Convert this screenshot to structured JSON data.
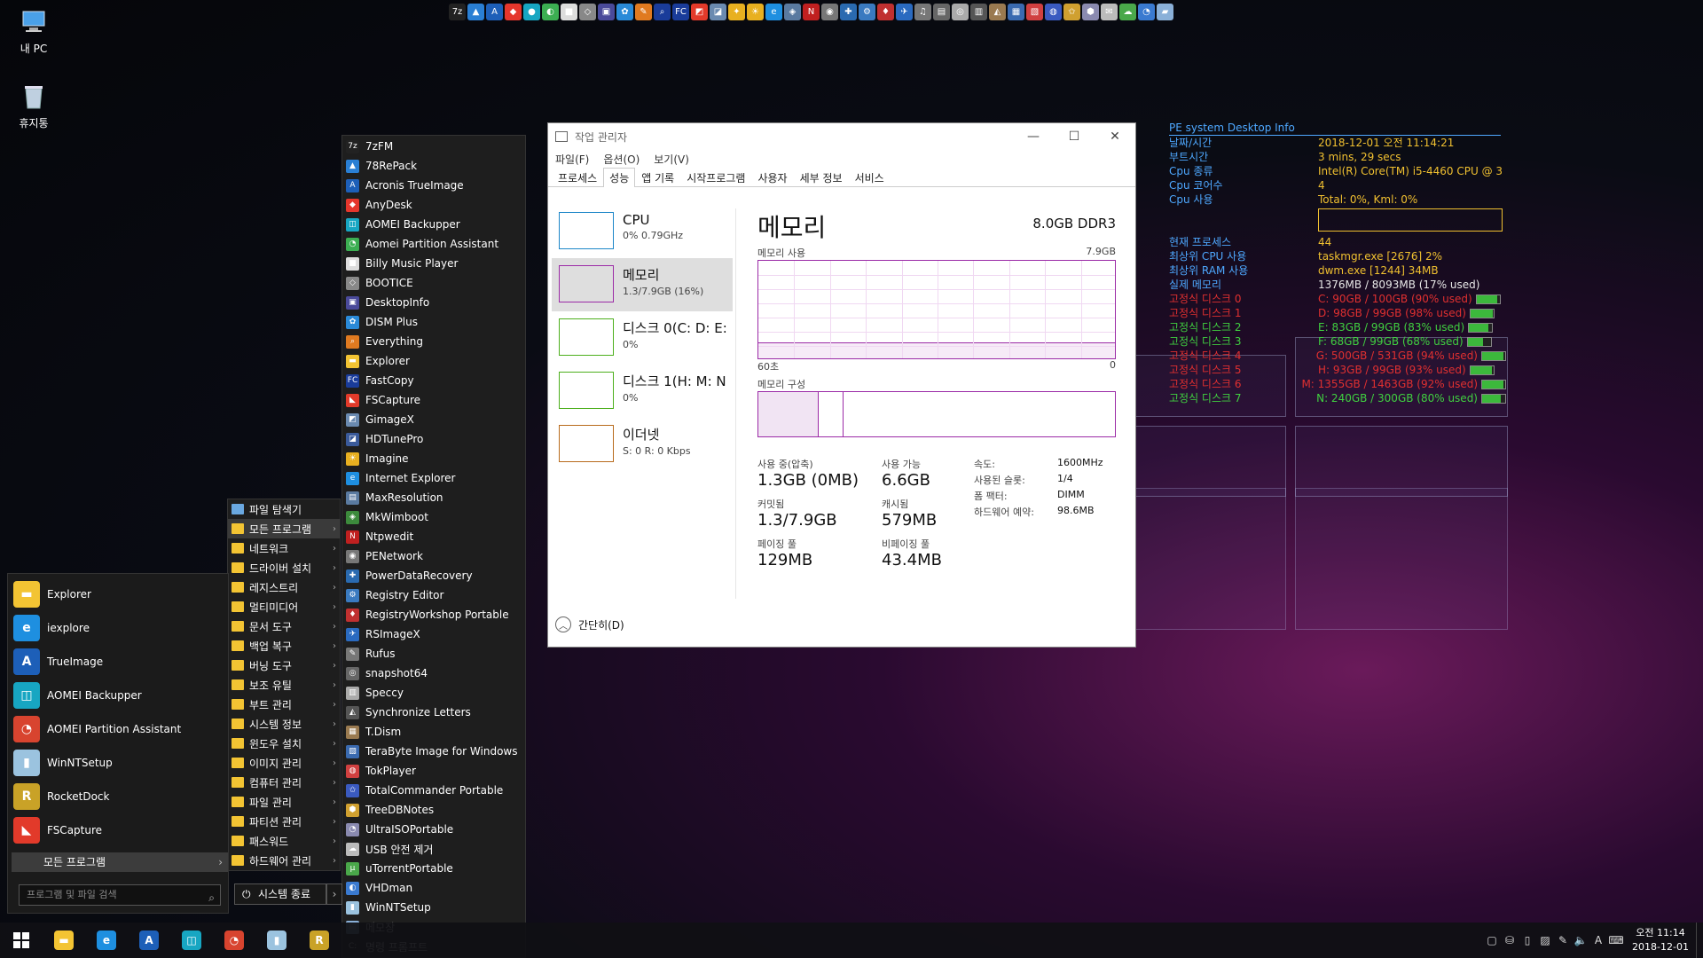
{
  "desktop": {
    "icons": [
      {
        "label": "내 PC",
        "icon": "computer-icon"
      },
      {
        "label": "휴지통",
        "icon": "recycle-bin-icon"
      }
    ]
  },
  "quickbar": {
    "icons": [
      "7z",
      "▲",
      "A",
      "◆",
      "●",
      "◐",
      "■",
      "◇",
      "▣",
      "✿",
      "✎",
      "⌕",
      "FC",
      "◩",
      "◪",
      "✦",
      "☀",
      "e",
      "◈",
      "N",
      "◉",
      "✚",
      "⚙",
      "♦",
      "✈",
      "♫",
      "▤",
      "◎",
      "▥",
      "◭",
      "▦",
      "▧",
      "◍",
      "✩",
      "⬢",
      "✉",
      "☁",
      "◔",
      "▰"
    ]
  },
  "desktop_info": {
    "title": "PE system  Desktop Info",
    "rows": [
      {
        "k": "날짜/시간",
        "v": "2018-12-01 오전 11:14:21",
        "style": "yellow"
      },
      {
        "k": "부트시간",
        "v": "3 mins, 29 secs",
        "style": "yellow"
      },
      {
        "k": "Cpu 종류",
        "v": "Intel(R) Core(TM) i5-4460  CPU @ 3",
        "style": "yellow"
      },
      {
        "k": "Cpu 코어수",
        "v": "4",
        "style": "yellow"
      },
      {
        "k": "Cpu 사용",
        "v": "Total: 0%, Kml: 0%",
        "style": "yellow"
      }
    ],
    "rows2": [
      {
        "k": "현재 프로세스",
        "v": "44",
        "style": "yellow"
      },
      {
        "k": "최상위 CPU 사용",
        "v": "taskmgr.exe [2676] 2%",
        "style": "yellow"
      },
      {
        "k": "최상위 RAM 사용",
        "v": "dwm.exe [1244] 34MB",
        "style": "yellow"
      },
      {
        "k": "실제 메모리",
        "v": "1376MB / 8093MB (17% used)",
        "style": "plain"
      }
    ],
    "disks": [
      {
        "k": "고정식 디스크 0",
        "v": "C: 90GB / 100GB (90% used)",
        "style": "red",
        "fill": 0.9
      },
      {
        "k": "고정식 디스크 1",
        "v": "D: 98GB / 99GB (98% used)",
        "style": "red",
        "fill": 0.98
      },
      {
        "k": "고정식 디스크 2",
        "v": "E: 83GB / 99GB (83% used)",
        "style": "green",
        "fill": 0.83
      },
      {
        "k": "고정식 디스크 3",
        "v": "F: 68GB / 99GB (68% used)",
        "style": "green",
        "fill": 0.68
      },
      {
        "k": "고정식 디스크 4",
        "v": "G: 500GB / 531GB (94% used)",
        "style": "red",
        "fill": 0.94
      },
      {
        "k": "고정식 디스크 5",
        "v": "H: 93GB / 99GB (93% used)",
        "style": "red",
        "fill": 0.93
      },
      {
        "k": "고정식 디스크 6",
        "v": "M: 1355GB / 1463GB (92% used)",
        "style": "red",
        "fill": 0.92
      },
      {
        "k": "고정식 디스크 7",
        "v": "N: 240GB / 300GB (80% used)",
        "style": "green",
        "fill": 0.8
      }
    ]
  },
  "start_menu": {
    "pinned": [
      {
        "label": "Explorer",
        "icon": "folder-icon",
        "color": "#f3c433",
        "glyph": "▬"
      },
      {
        "label": "iexplore",
        "icon": "ie-icon",
        "color": "#1e8fe0",
        "glyph": "e"
      },
      {
        "label": "TrueImage",
        "icon": "trueimage-icon",
        "color": "#1d5fb8",
        "glyph": "A"
      },
      {
        "label": "AOMEI Backupper",
        "icon": "backupper-icon",
        "color": "#17a6c2",
        "glyph": "◫"
      },
      {
        "label": "AOMEI Partition Assistant",
        "icon": "partition-icon",
        "color": "#d8442f",
        "glyph": "◔"
      },
      {
        "label": "WinNTSetup",
        "icon": "winntsetup-icon",
        "color": "#9bc3df",
        "glyph": "▮"
      },
      {
        "label": "RocketDock",
        "icon": "rocketdock-icon",
        "color": "#c9a227",
        "glyph": "R"
      },
      {
        "label": "FSCapture",
        "icon": "fscapture-icon",
        "color": "#e23a2a",
        "glyph": "◣"
      }
    ],
    "all_programs": "모든 프로그램",
    "search_placeholder": "프로그램 및 파일 검색",
    "shutdown": "시스템 종료"
  },
  "submenu": {
    "items": [
      {
        "label": "파일 탐색기",
        "arrow": false
      },
      {
        "label": "모든 프로그램",
        "arrow": true,
        "active": true
      },
      {
        "label": "네트워크",
        "arrow": true
      },
      {
        "label": "드라이버 설치",
        "arrow": true
      },
      {
        "label": "레지스트리",
        "arrow": true
      },
      {
        "label": "멀티미디어",
        "arrow": true
      },
      {
        "label": "문서 도구",
        "arrow": true
      },
      {
        "label": "백업 복구",
        "arrow": true
      },
      {
        "label": "버닝 도구",
        "arrow": true
      },
      {
        "label": "보조 유틸",
        "arrow": true
      },
      {
        "label": "부트 관리",
        "arrow": true
      },
      {
        "label": "시스템 정보",
        "arrow": true
      },
      {
        "label": "윈도우 설치",
        "arrow": true
      },
      {
        "label": "이미지 관리",
        "arrow": true
      },
      {
        "label": "컴퓨터 관리",
        "arrow": true
      },
      {
        "label": "파일 관리",
        "arrow": true
      },
      {
        "label": "파티션 관리",
        "arrow": true
      },
      {
        "label": "패스워드",
        "arrow": true
      },
      {
        "label": "하드웨어 관리",
        "arrow": true
      }
    ]
  },
  "programs": [
    {
      "label": "7zFM",
      "color": "#222",
      "glyph": "7z"
    },
    {
      "label": "78RePack",
      "color": "#2a7fd4",
      "glyph": "▲"
    },
    {
      "label": "Acronis TrueImage",
      "color": "#1d5fb8",
      "glyph": "A"
    },
    {
      "label": "AnyDesk",
      "color": "#e5362c",
      "glyph": "◆"
    },
    {
      "label": "AOMEI Backupper",
      "color": "#17a6c2",
      "glyph": "◫"
    },
    {
      "label": "Aomei Partition Assistant",
      "color": "#3cae52",
      "glyph": "◔"
    },
    {
      "label": "Billy Music Player",
      "color": "#ddd",
      "glyph": "■"
    },
    {
      "label": "BOOTICE",
      "color": "#888",
      "glyph": "◇"
    },
    {
      "label": "DesktopInfo",
      "color": "#4a4a9a",
      "glyph": "▣"
    },
    {
      "label": "DISM Plus",
      "color": "#2a8ad8",
      "glyph": "✿"
    },
    {
      "label": "Everything",
      "color": "#e07a20",
      "glyph": "⌕"
    },
    {
      "label": "Explorer",
      "color": "#f3c433",
      "glyph": "▬"
    },
    {
      "label": "FastCopy",
      "color": "#1a3c9a",
      "glyph": "FC"
    },
    {
      "label": "FSCapture",
      "color": "#e23a2a",
      "glyph": "◣"
    },
    {
      "label": "GimageX",
      "color": "#6a8ab0",
      "glyph": "◩"
    },
    {
      "label": "HDTunePro",
      "color": "#3a5a9a",
      "glyph": "◪"
    },
    {
      "label": "Imagine",
      "color": "#e8b020",
      "glyph": "☀"
    },
    {
      "label": "Internet Explorer",
      "color": "#1e8fe0",
      "glyph": "e"
    },
    {
      "label": "MaxResolution",
      "color": "#5a7aa0",
      "glyph": "▤"
    },
    {
      "label": "MkWimboot",
      "color": "#3c8a3c",
      "glyph": "◈"
    },
    {
      "label": "Ntpwedit",
      "color": "#c02020",
      "glyph": "N"
    },
    {
      "label": "PENetwork",
      "color": "#777",
      "glyph": "◉"
    },
    {
      "label": "PowerDataRecovery",
      "color": "#2a6ab0",
      "glyph": "✚"
    },
    {
      "label": "Registry Editor",
      "color": "#3a7ac0",
      "glyph": "⚙"
    },
    {
      "label": "RegistryWorkshop Portable",
      "color": "#c03030",
      "glyph": "♦"
    },
    {
      "label": "RSImageX",
      "color": "#2a6ac0",
      "glyph": "✈"
    },
    {
      "label": "Rufus",
      "color": "#777",
      "glyph": "✎"
    },
    {
      "label": "snapshot64",
      "color": "#666",
      "glyph": "◎"
    },
    {
      "label": "Speccy",
      "color": "#aaa",
      "glyph": "▥"
    },
    {
      "label": "Synchronize Letters",
      "color": "#555",
      "glyph": "◭"
    },
    {
      "label": "T.Dism",
      "color": "#9a7a50",
      "glyph": "▦"
    },
    {
      "label": "TeraByte Image for Windows",
      "color": "#3a6ab0",
      "glyph": "▧"
    },
    {
      "label": "TokPlayer",
      "color": "#d04040",
      "glyph": "◍"
    },
    {
      "label": "TotalCommander Portable",
      "color": "#3a5ac0",
      "glyph": "✩"
    },
    {
      "label": "TreeDBNotes",
      "color": "#d0a030",
      "glyph": "⬢"
    },
    {
      "label": "UltraISOPortable",
      "color": "#8a8ab0",
      "glyph": "◔"
    },
    {
      "label": "USB 안전 제거",
      "color": "#bbb",
      "glyph": "☁"
    },
    {
      "label": "uTorrentPortable",
      "color": "#4aa84a",
      "glyph": "µ"
    },
    {
      "label": "VHDman",
      "color": "#3a7ad0",
      "glyph": "◐"
    },
    {
      "label": "WinNTSetup",
      "color": "#9bc3df",
      "glyph": "▮"
    },
    {
      "label": "메모장",
      "color": "#8ab0d8",
      "glyph": "▤"
    },
    {
      "label": "명령 프롬프트",
      "color": "#111",
      "glyph": "C:"
    }
  ],
  "taskmgr": {
    "title": "작업 관리자",
    "menu": [
      "파일(F)",
      "옵션(O)",
      "보기(V)"
    ],
    "tabs": [
      "프로세스",
      "성능",
      "앱 기록",
      "시작프로그램",
      "사용자",
      "세부 정보",
      "서비스"
    ],
    "active_tab": 1,
    "resources": [
      {
        "name": "CPU",
        "sub": "0% 0.79GHz",
        "color": "#1c86c8",
        "active": false
      },
      {
        "name": "메모리",
        "sub": "1.3/7.9GB (16%)",
        "color": "#9b2aa6",
        "active": true
      },
      {
        "name": "디스크 0(C: D: E:",
        "sub": "0%",
        "color": "#4caf1c",
        "active": false
      },
      {
        "name": "디스크 1(H: M: N",
        "sub": "0%",
        "color": "#4caf1c",
        "active": false
      },
      {
        "name": "이더넷",
        "sub": "S: 0 R: 0 Kbps",
        "color": "#b86a1c",
        "active": false
      }
    ],
    "heading": "메모리",
    "spec": "8.0GB DDR3",
    "usage_label": "메모리 사용",
    "usage_max": "7.9GB",
    "time_left": "60초",
    "time_right": "0",
    "usage_fraction": 0.16,
    "comp_label": "메모리 구성",
    "stats": {
      "in_use_label": "사용 중(압축)",
      "in_use": "1.3GB (0MB)",
      "available_label": "사용 가능",
      "available": "6.6GB",
      "committed_label": "커밋됨",
      "committed": "1.3/7.9GB",
      "cached_label": "캐시됨",
      "cached": "579MB",
      "paged_label": "페이징 풀",
      "paged": "129MB",
      "nonpaged_label": "비페이징 풀",
      "nonpaged": "43.4MB"
    },
    "kv": [
      {
        "k": "속도:",
        "v": "1600MHz"
      },
      {
        "k": "사용된 슬롯:",
        "v": "1/4"
      },
      {
        "k": "폼 팩터:",
        "v": "DIMM"
      },
      {
        "k": "하드웨어 예약:",
        "v": "98.6MB"
      }
    ],
    "footer": "간단히(D)"
  },
  "taskbar": {
    "apps": [
      {
        "name": "taskbar-explorer",
        "color": "#f3c433",
        "glyph": "▬"
      },
      {
        "name": "taskbar-ie",
        "color": "#1e8fe0",
        "glyph": "e"
      },
      {
        "name": "taskbar-trueimage",
        "color": "#1d5fb8",
        "glyph": "A"
      },
      {
        "name": "taskbar-backupper",
        "color": "#17a6c2",
        "glyph": "◫"
      },
      {
        "name": "taskbar-partition",
        "color": "#d8442f",
        "glyph": "◔"
      },
      {
        "name": "taskbar-winntsetup",
        "color": "#9bc3df",
        "glyph": "▮"
      },
      {
        "name": "taskbar-rocketdock",
        "color": "#c9a227",
        "glyph": "R"
      }
    ],
    "tray": [
      "▢",
      "⛁",
      "▯",
      "▨",
      "✎",
      "🔈",
      "A",
      "⌨"
    ],
    "time": "오전 11:14",
    "date": "2018-12-01"
  }
}
